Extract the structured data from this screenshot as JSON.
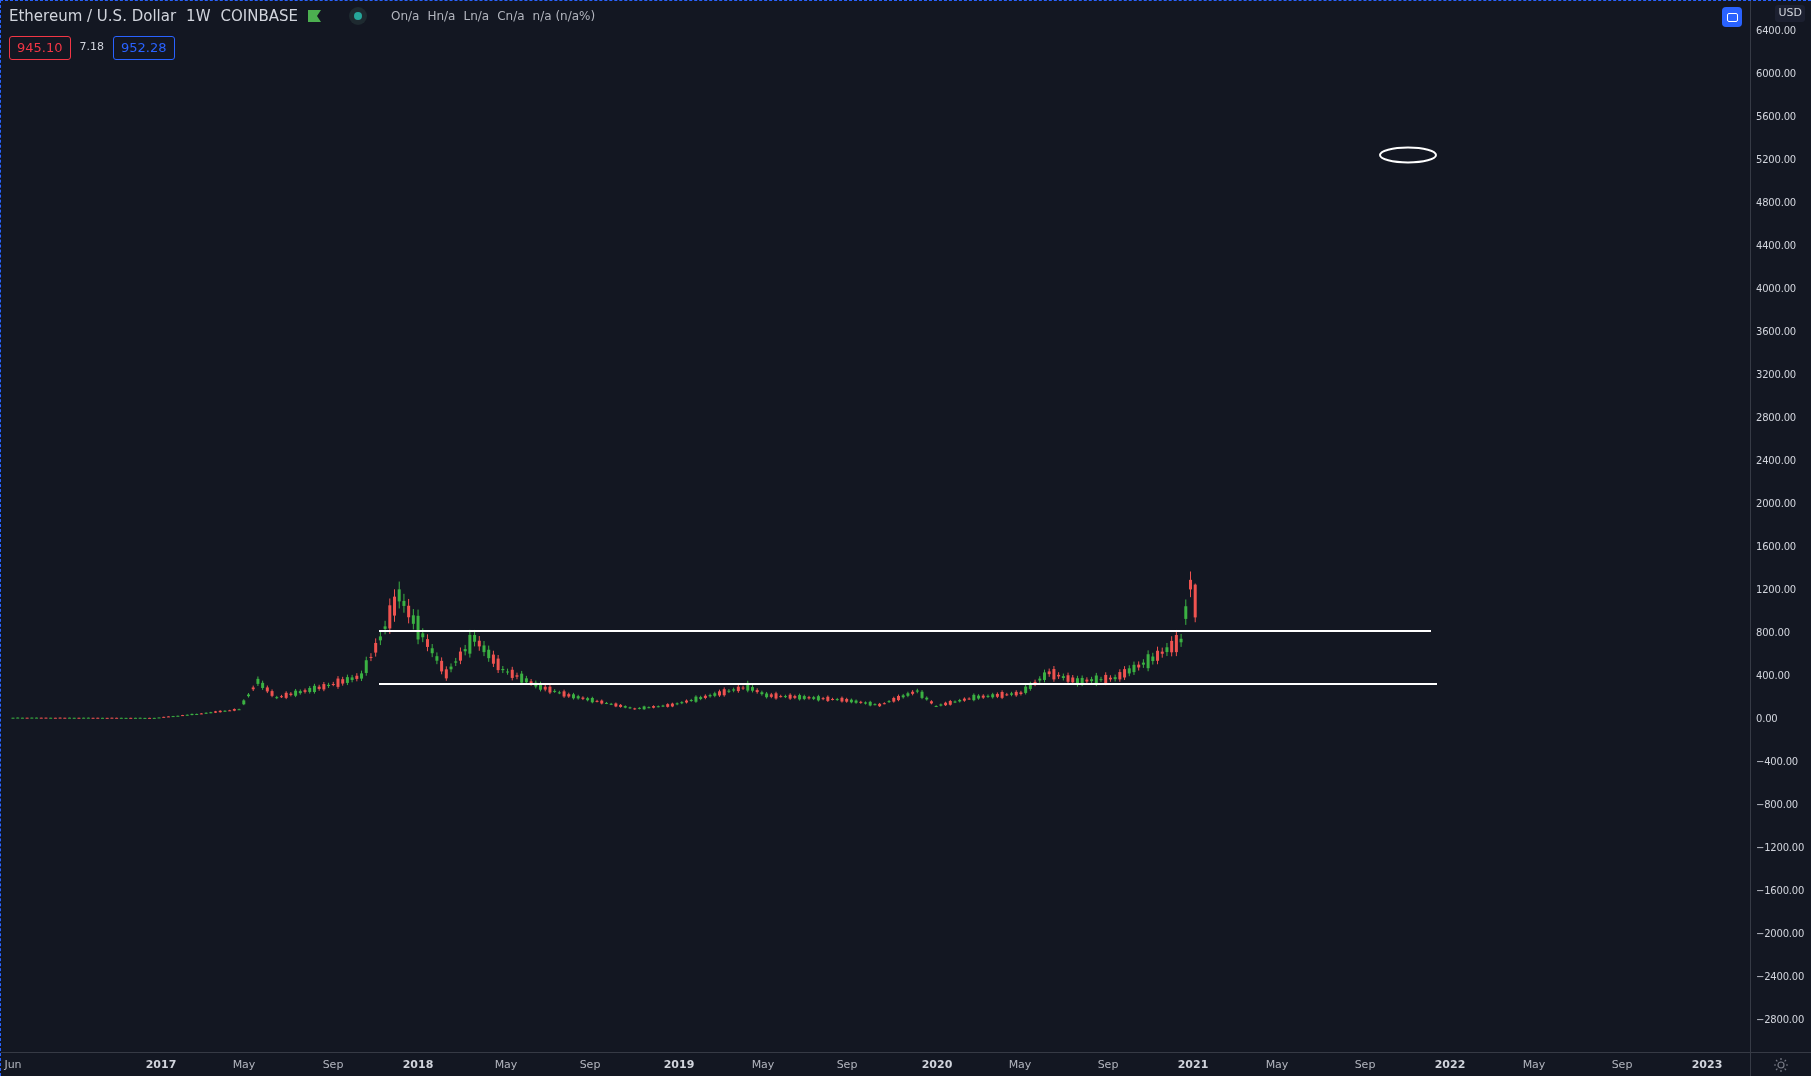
{
  "legend": {
    "title": "Ethereum / U.S. Dollar",
    "interval": "1W",
    "exchange": "COINBASE",
    "ohlc": [
      {
        "label": "O",
        "value": "n/a"
      },
      {
        "label": "H",
        "value": "n/a"
      },
      {
        "label": "L",
        "value": "n/a"
      },
      {
        "label": "C",
        "value": "n/a"
      }
    ],
    "change": "n/a (n/a%)",
    "sell_price": "945.10",
    "spread": "7.18",
    "buy_price": "952.28"
  },
  "price_axis": {
    "currency": "USD",
    "labels": [
      "6400.00",
      "6000.00",
      "5600.00",
      "5200.00",
      "4800.00",
      "4400.00",
      "4000.00",
      "3600.00",
      "3200.00",
      "2800.00",
      "2400.00",
      "2000.00",
      "1600.00",
      "1200.00",
      "800.00",
      "400.00",
      "0.00",
      "−400.00",
      "−800.00",
      "−1200.00",
      "−1600.00",
      "−2000.00",
      "−2400.00",
      "−2800.00"
    ]
  },
  "time_axis": {
    "labels": [
      "Jun",
      "2017",
      "May",
      "Sep",
      "2018",
      "May",
      "Sep",
      "2019",
      "May",
      "Sep",
      "2020",
      "May",
      "Sep",
      "2021",
      "May",
      "Sep",
      "2022",
      "May",
      "Sep",
      "2023"
    ]
  }
}
